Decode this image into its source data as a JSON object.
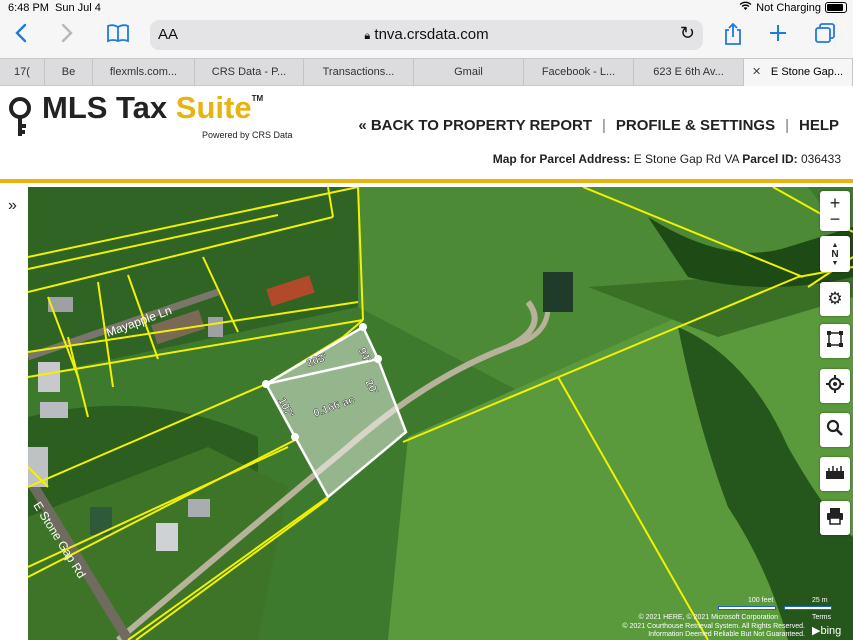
{
  "status_bar": {
    "time": "6:48 PM",
    "date": "Sun Jul 4",
    "charging": "Not Charging"
  },
  "browser": {
    "text_size_label": "AA",
    "url": "tnva.crsdata.com"
  },
  "tabs": [
    {
      "label": "17("
    },
    {
      "label": "Be"
    },
    {
      "label": "flexmls.com..."
    },
    {
      "label": "CRS Data - P..."
    },
    {
      "label": "Transactions..."
    },
    {
      "label": "Gmail"
    },
    {
      "label": "Facebook - L..."
    },
    {
      "label": "623 E 6th Av..."
    },
    {
      "label": "E Stone Gap...",
      "active": true
    }
  ],
  "header": {
    "logo_part1": "MLS Tax ",
    "logo_part2": "Suite",
    "logo_tm": "TM",
    "logo_sub": "Powered by CRS Data",
    "nav": {
      "back": "« BACK TO PROPERTY REPORT",
      "profile": "PROFILE & SETTINGS",
      "help": "HELP"
    },
    "parcel_address_label": "Map for Parcel Address:",
    "parcel_address": "E Stone Gap Rd VA",
    "parcel_id_label": "Parcel ID:",
    "parcel_id": "036433"
  },
  "map": {
    "street_labels": {
      "mayapple": "Mayapple Ln",
      "stone_gap": "E Stone Gap Rd"
    },
    "parcel_dimensions": {
      "top": "203'",
      "right_upper": "94'",
      "right_lower": "20'",
      "left": "107'",
      "area": "0.166 ac"
    },
    "controls": {
      "zoom_in": "+",
      "zoom_out": "−",
      "north": "N"
    },
    "scale": {
      "feet": "100 feet",
      "meters": "25 m"
    },
    "attribution": {
      "line1": "© 2021 HERE, © 2021 Microsoft Corporation",
      "terms": "Terms",
      "line2": "© 2021 Courthouse Retrieval System. All Rights Reserved.",
      "line3": "Information Deemed Reliable But Not Guaranteed.",
      "bing": "bing"
    },
    "colors": {
      "parcel_lines": "#f2f200",
      "subject_parcel": "#ffffff",
      "grass": "#3e7a2e"
    }
  }
}
